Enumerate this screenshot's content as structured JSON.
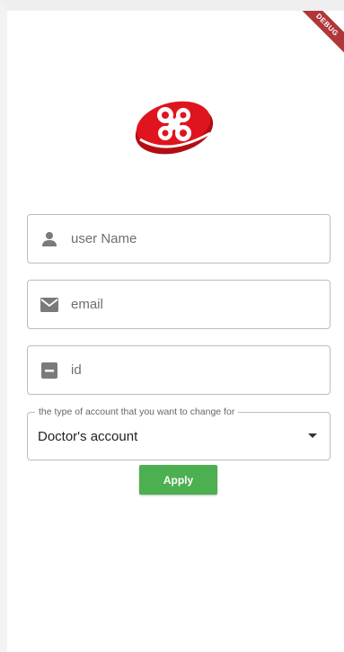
{
  "debug_banner": "DEBUG",
  "form": {
    "username": {
      "value": "user Name",
      "icon": "person-icon"
    },
    "email": {
      "value": "email",
      "icon": "mail-icon"
    },
    "id": {
      "value": "id",
      "icon": "id-card-icon"
    },
    "account_type": {
      "label": "the type of account that you want to change for",
      "selected": "Doctor's account"
    },
    "apply_label": "Apply"
  },
  "colors": {
    "logo_red": "#e0141e",
    "apply_green": "#4caf50",
    "icon_gray": "#7a7a7a",
    "border": "#bdbdbd"
  }
}
